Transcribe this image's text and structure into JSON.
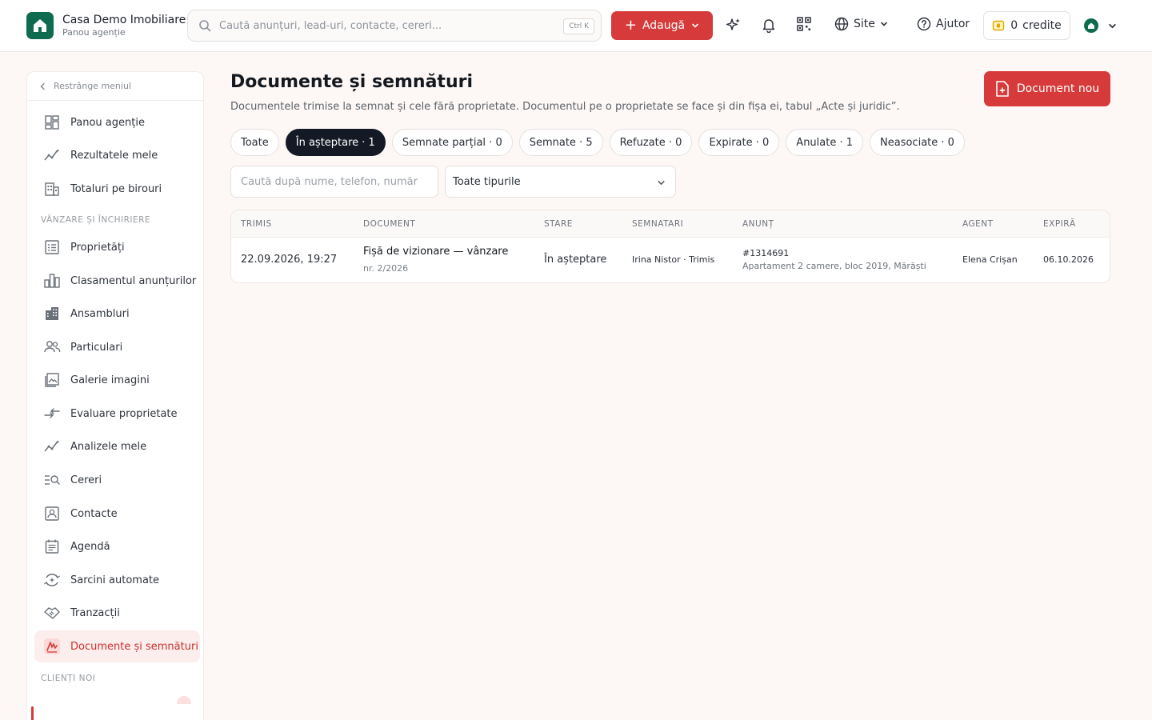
{
  "brand": {
    "name": "Casa Demo Imobiliare",
    "subtitle": "Panou agenție"
  },
  "search": {
    "placeholder": "Caută anunțuri, lead-uri, contacte, cereri...",
    "shortcut": "Ctrl K"
  },
  "header": {
    "add_label": "Adaugă",
    "site_label": "Site",
    "help_label": "Ajutor",
    "credits_count": "0",
    "credits_label": "credite"
  },
  "sidebar": {
    "collapse_label": "Restrânge meniul",
    "top_items": [
      {
        "label": "Panou agenție",
        "icon": "dashboard-icon"
      },
      {
        "label": "Rezultatele mele",
        "icon": "sparkline-icon"
      },
      {
        "label": "Totaluri pe birouri",
        "icon": "building-icon"
      }
    ],
    "section_sales": "VÂNZARE ȘI ÎNCHIRIERE",
    "sales_items": [
      {
        "label": "Proprietăți",
        "icon": "list-icon"
      },
      {
        "label": "Clasamentul anunțurilor",
        "icon": "bar-chart-icon"
      },
      {
        "label": "Ansambluri",
        "icon": "apartment-icon"
      },
      {
        "label": "Particulari",
        "icon": "people-icon"
      },
      {
        "label": "Galerie imagini",
        "icon": "image-gallery-icon"
      },
      {
        "label": "Evaluare proprietate",
        "icon": "compare-arrows-icon"
      },
      {
        "label": "Analizele mele",
        "icon": "analytics-icon"
      },
      {
        "label": "Cereri",
        "icon": "search-list-icon"
      },
      {
        "label": "Contacte",
        "icon": "contact-card-icon"
      },
      {
        "label": "Agendă",
        "icon": "calendar-icon"
      },
      {
        "label": "Sarcini automate",
        "icon": "automation-icon"
      },
      {
        "label": "Tranzacții",
        "icon": "handshake-icon"
      },
      {
        "label": "Documente și semnături",
        "icon": "signature-icon"
      }
    ],
    "section_clients": "CLIENȚI NOI"
  },
  "main": {
    "title": "Documente și semnături",
    "description": "Documentele trimise la semnat și cele fără proprietate. Documentul pe o proprietate se face și din fișa ei, tabul „Acte și juridic”.",
    "new_doc_label": "Document nou",
    "tabs": [
      {
        "label": "Toate",
        "active": false
      },
      {
        "label": "În așteptare · 1",
        "active": true
      },
      {
        "label": "Semnate parțial · 0",
        "active": false
      },
      {
        "label": "Semnate · 5",
        "active": false
      },
      {
        "label": "Refuzate · 0",
        "active": false
      },
      {
        "label": "Expirate · 0",
        "active": false
      },
      {
        "label": "Anulate · 1",
        "active": false
      },
      {
        "label": "Neasociate · 0",
        "active": false
      }
    ],
    "filter_search_placeholder": "Caută după nume, telefon, număr",
    "filter_type": "Toate tipurile"
  },
  "table": {
    "columns": [
      "TRIMIS",
      "DOCUMENT",
      "STARE",
      "SEMNATARI",
      "ANUNȚ",
      "AGENT",
      "EXPIRĂ"
    ],
    "rows": [
      {
        "sent": "22.09.2026, 19:27",
        "document": "Fișă de vizionare — vânzare",
        "doc_number": "nr. 2/2026",
        "status": "În așteptare",
        "signers": "Irina Nistor · Trimis",
        "listing_id": "#1314691",
        "listing_desc": "Apartament 2 camere, bloc 2019, Mărăști",
        "agent": "Elena Crișan",
        "expires": "06.10.2026"
      }
    ]
  },
  "colors": {
    "accent": "#d63a3a",
    "brand": "#0f6b4f",
    "dark": "#131a26"
  }
}
